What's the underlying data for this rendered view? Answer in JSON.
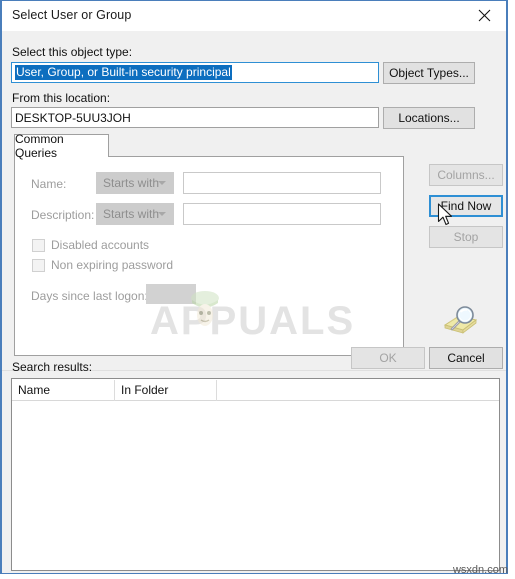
{
  "window": {
    "title": "Select User or Group",
    "close_icon": "close-icon"
  },
  "object_type": {
    "label": "Select this object type:",
    "value": "User, Group, or Built-in security principal",
    "button": "Object Types..."
  },
  "location": {
    "label": "From this location:",
    "value": "DESKTOP-5UU3JOH",
    "button": "Locations..."
  },
  "tabs": [
    {
      "label": "Common Queries",
      "selected": true
    }
  ],
  "query_form": {
    "name_label": "Name:",
    "name_operator": "Starts with",
    "name_value": "",
    "description_label": "Description:",
    "description_operator": "Starts with",
    "description_value": "",
    "disabled_accounts_label": "Disabled accounts",
    "disabled_accounts_checked": false,
    "non_expiring_password_label": "Non expiring password",
    "non_expiring_password_checked": false,
    "days_since_logon_label": "Days since last logon:",
    "days_since_logon_value": "",
    "search_icon": "magnifier-folder-icon"
  },
  "side_buttons": {
    "columns": "Columns...",
    "find_now": "Find Now",
    "stop": "Stop"
  },
  "footer_buttons": {
    "ok": "OK",
    "cancel": "Cancel"
  },
  "results": {
    "label": "Search results:",
    "columns": [
      "Name",
      "In Folder"
    ],
    "rows": []
  },
  "watermark": {
    "text": "APPUALS"
  },
  "credit": {
    "text": "wsxdn.com"
  },
  "colors": {
    "accent": "#0d6ebf",
    "dialog_border": "#4a7ebb",
    "dialog_bg": "#f0f0f0",
    "disabled_text": "#9d9d9d"
  }
}
